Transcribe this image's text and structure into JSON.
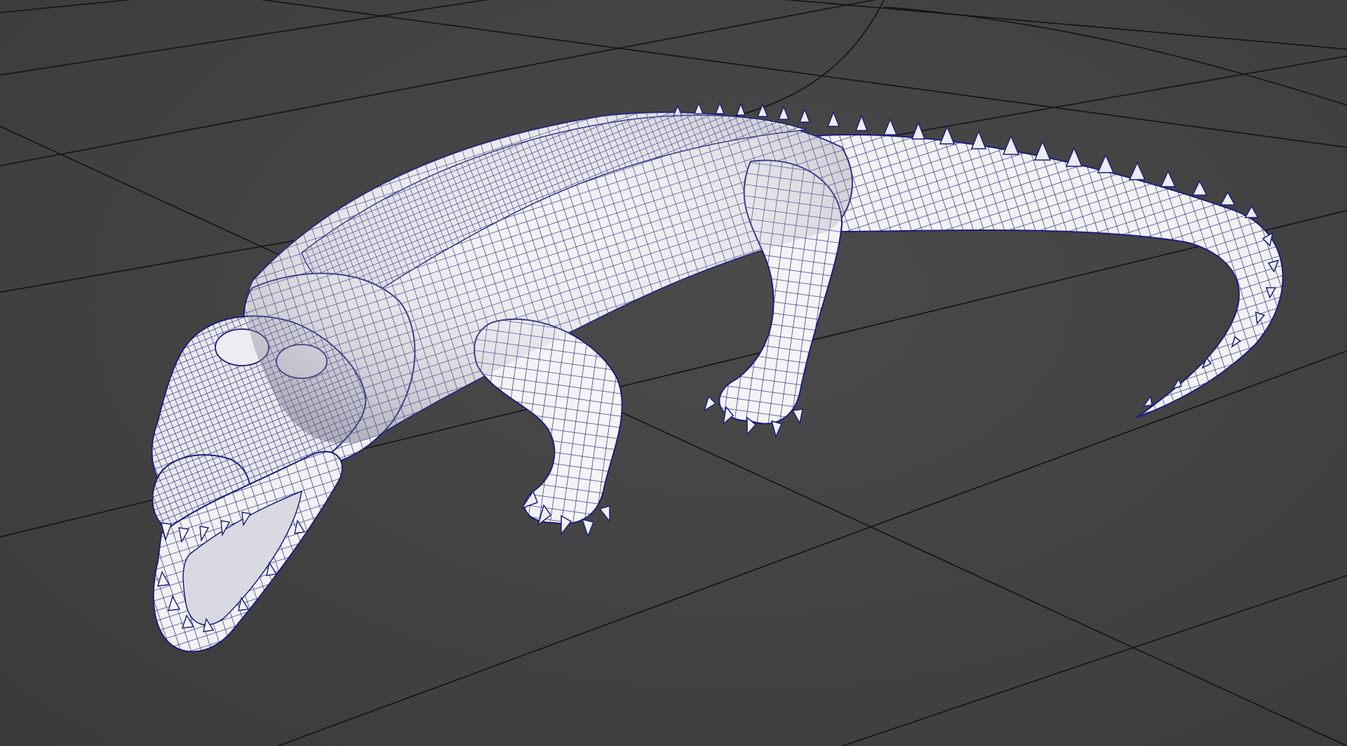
{
  "viewport": {
    "kind": "3d-viewport",
    "shading": "wireframe-on-shaded",
    "background_color": "#424242",
    "grid_color": "#141414",
    "mesh_base_color": "#f2f2f4",
    "wireframe_color": "#1c1f7a",
    "grid_visible": true
  },
  "model": {
    "subject": "crocodile",
    "pose": "mouth-open"
  }
}
